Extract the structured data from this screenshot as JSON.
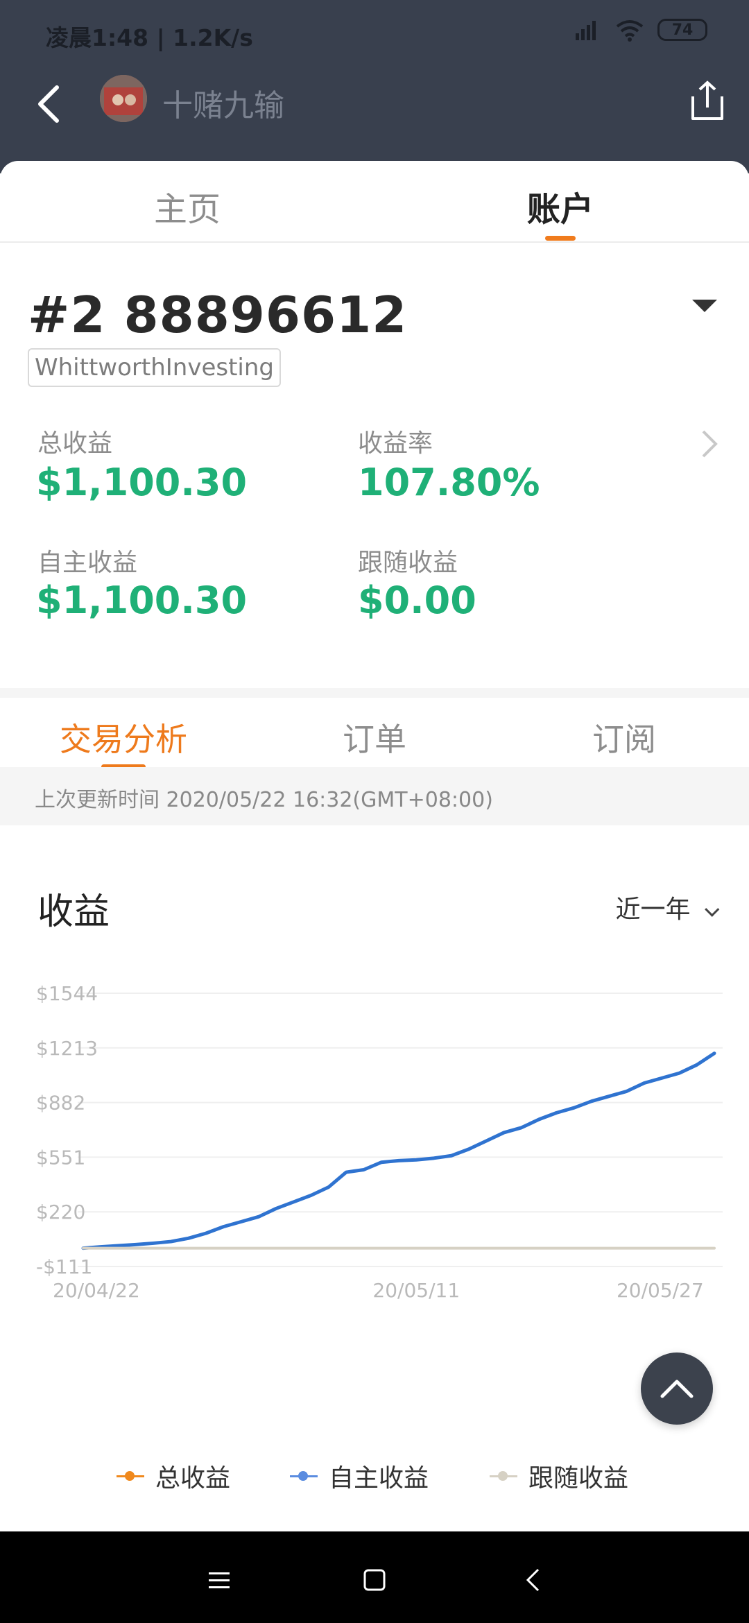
{
  "status_bar": {
    "time_and_speed": "凌晨1:48 | 1.2K/s",
    "battery": "74"
  },
  "header": {
    "nickname": "十赌九输"
  },
  "top_tabs": [
    {
      "label": "主页",
      "active": false
    },
    {
      "label": "账户",
      "active": true
    }
  ],
  "account": {
    "number": "#2 88896612",
    "broker": "WhittworthInvesting"
  },
  "stats": {
    "total_profit_label": "总收益",
    "total_profit_value": "$1,100.30",
    "return_rate_label": "收益率",
    "return_rate_value": "107.80%",
    "self_profit_label": "自主收益",
    "self_profit_value": "$1,100.30",
    "follow_profit_label": "跟随收益",
    "follow_profit_value": "$0.00"
  },
  "sub_tabs": [
    {
      "label": "交易分析",
      "active": true
    },
    {
      "label": "订单",
      "active": false
    },
    {
      "label": "订阅",
      "active": false
    }
  ],
  "last_update": "上次更新时间 2020/05/22 16:32(GMT+08:00)",
  "chart_header": {
    "title": "收益",
    "period": "近一年"
  },
  "colors": {
    "accent_orange": "#ee7a1c",
    "profit_green": "#1fb077",
    "series_blue": "#2f73d0"
  },
  "chart_data": {
    "type": "line",
    "title": "",
    "xlabel": "",
    "ylabel": "",
    "ylim": [
      -111,
      1544
    ],
    "y_ticks": [
      "$1544",
      "$1213",
      "$882",
      "$551",
      "$220",
      "-$111"
    ],
    "y_tick_values": [
      1544,
      1213,
      882,
      551,
      220,
      -111
    ],
    "x_ticks": [
      "20/04/22",
      "20/05/11",
      "20/05/27"
    ],
    "x_tick_positions": [
      0,
      19,
      35
    ],
    "x": [
      0,
      1,
      2,
      3,
      4,
      5,
      6,
      7,
      8,
      9,
      10,
      11,
      12,
      13,
      14,
      15,
      16,
      17,
      18,
      19,
      20,
      21,
      22,
      23,
      24,
      25,
      26,
      27,
      28,
      29,
      30,
      31,
      32,
      33,
      34,
      35,
      36
    ],
    "grid": true,
    "legend": "bottom",
    "series": [
      {
        "name": "自主收益",
        "color": "#2f73d0",
        "values": [
          0,
          8,
          15,
          22,
          30,
          40,
          60,
          90,
          130,
          160,
          190,
          240,
          280,
          320,
          370,
          460,
          475,
          520,
          530,
          535,
          545,
          560,
          600,
          650,
          700,
          730,
          780,
          820,
          850,
          890,
          920,
          950,
          1000,
          1030,
          1060,
          1110,
          1180
        ]
      },
      {
        "name": "跟随收益",
        "color": "#d6d1c4",
        "values": [
          0,
          0,
          0,
          0,
          0,
          0,
          0,
          0,
          0,
          0,
          0,
          0,
          0,
          0,
          0,
          0,
          0,
          0,
          0,
          0,
          0,
          0,
          0,
          0,
          0,
          0,
          0,
          0,
          0,
          0,
          0,
          0,
          0,
          0,
          0,
          0,
          0
        ]
      }
    ],
    "legend_entries": [
      {
        "name": "总收益",
        "color": "#f0891d"
      },
      {
        "name": "自主收益",
        "color": "#5a8ce0"
      },
      {
        "name": "跟随收益",
        "color": "#d6d1c4"
      }
    ]
  }
}
